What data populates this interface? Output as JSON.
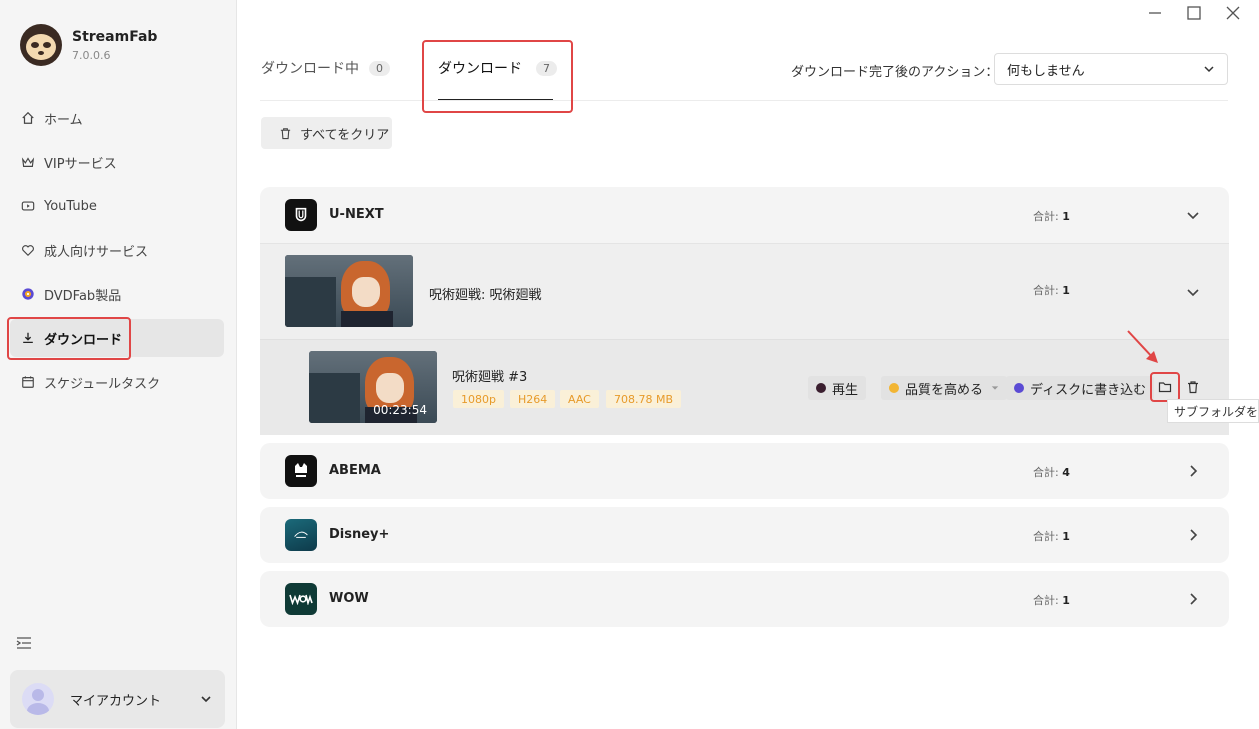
{
  "app": {
    "name": "StreamFab",
    "version": "7.0.0.6"
  },
  "sidebar": {
    "items": [
      {
        "label": "ホーム",
        "icon": "home-icon"
      },
      {
        "label": "VIPサービス",
        "icon": "crown-icon"
      },
      {
        "label": "YouTube",
        "icon": "youtube-icon"
      },
      {
        "label": "成人向けサービス",
        "icon": "heart-icon"
      },
      {
        "label": "DVDFab製品",
        "icon": "dvdfab-icon"
      },
      {
        "label": "ダウンロード",
        "icon": "download-icon",
        "active": true
      },
      {
        "label": "スケジュールタスク",
        "icon": "calendar-icon"
      }
    ],
    "account_label": "マイアカウント"
  },
  "tabs": [
    {
      "label": "ダウンロード中",
      "count": "0"
    },
    {
      "label": "ダウンロード",
      "count": "7",
      "active": true
    }
  ],
  "after_download": {
    "label": "ダウンロード完了後のアクション：",
    "selected": "何もしません"
  },
  "toolbar": {
    "clear_all": "すべてをクリア"
  },
  "total_label": "合計:",
  "groups": [
    {
      "name": "U-NEXT",
      "total": "1",
      "expanded": true
    },
    {
      "name": "ABEMA",
      "total": "4"
    },
    {
      "name": "Disney+",
      "total": "1"
    },
    {
      "name": "WOW",
      "total": "1"
    }
  ],
  "series": {
    "title": "呪術廻戦: 呪術廻戦",
    "total": "1"
  },
  "episode": {
    "title": "呪術廻戦 #3",
    "duration": "00:23:54",
    "tags": [
      "1080p",
      "H264",
      "AAC",
      "708.78 MB"
    ]
  },
  "actions": {
    "play": "再生",
    "enhance": "品質を高める",
    "burn": "ディスクに書き込む"
  },
  "tooltip": "サブフォルダを開く",
  "colors": {
    "highlight": "#e04646",
    "tag_text": "#e79a2a",
    "tag_bg": "#faf0d8"
  }
}
